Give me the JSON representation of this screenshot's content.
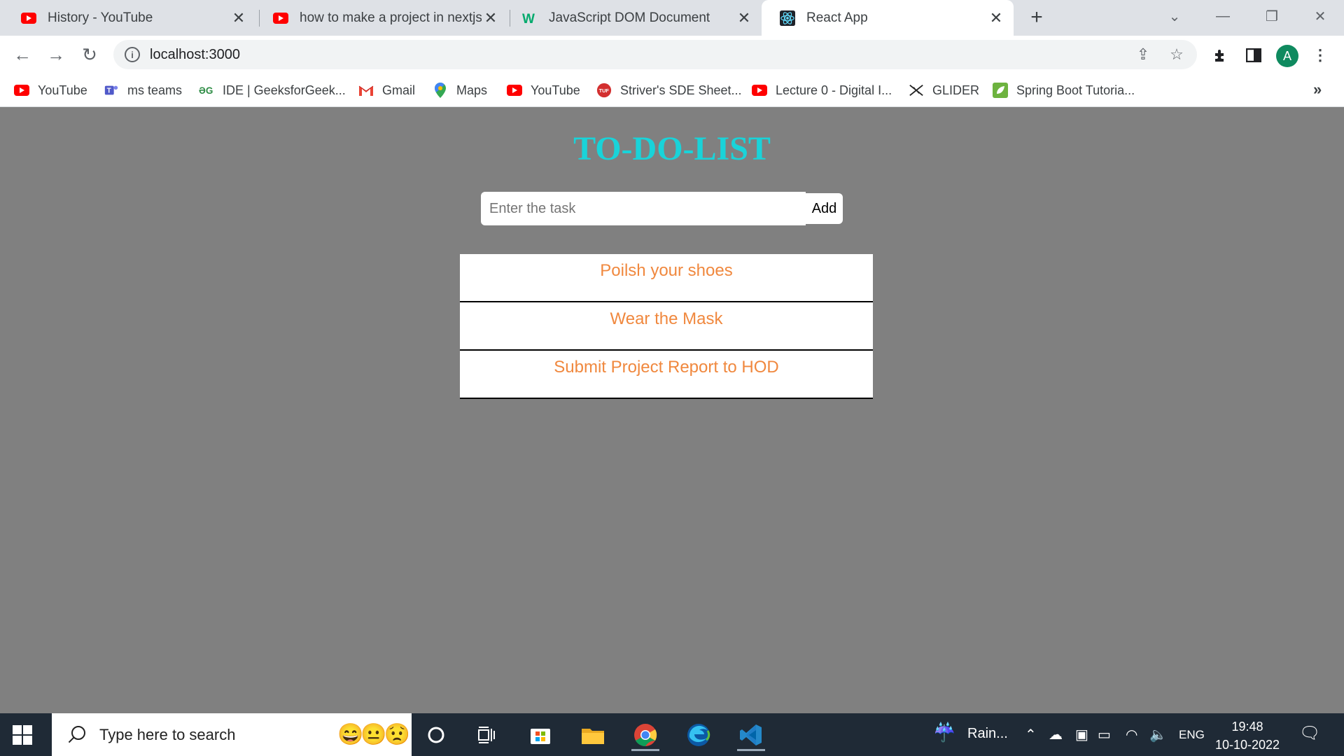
{
  "browser": {
    "tabs": [
      {
        "title": "History - YouTube",
        "icon": "youtube-icon"
      },
      {
        "title": "how to make a project in nextjs - ",
        "icon": "youtube-icon"
      },
      {
        "title": "JavaScript DOM Document",
        "icon": "w3-icon"
      },
      {
        "title": "React App",
        "icon": "react-icon",
        "active": true
      }
    ],
    "url": "localhost:3000",
    "profile_initial": "A",
    "bookmarks": [
      {
        "label": "YouTube",
        "icon": "youtube-icon"
      },
      {
        "label": "ms teams",
        "icon": "teams-icon"
      },
      {
        "label": "IDE | GeeksforGeek...",
        "icon": "gfg-icon"
      },
      {
        "label": "Gmail",
        "icon": "gmail-icon"
      },
      {
        "label": "Maps",
        "icon": "maps-icon"
      },
      {
        "label": "YouTube",
        "icon": "youtube-icon"
      },
      {
        "label": "Striver's SDE Sheet...",
        "icon": "tuf-icon"
      },
      {
        "label": "Lecture 0 - Digital I...",
        "icon": "youtube-icon"
      },
      {
        "label": "GLIDER",
        "icon": "glider-icon"
      },
      {
        "label": "Spring Boot Tutoria...",
        "icon": "spring-icon"
      }
    ],
    "bookmarks_more": "»"
  },
  "app": {
    "title": "TO-DO-LIST",
    "input_placeholder": "Enter the task",
    "add_label": "Add",
    "tasks": [
      "Poilsh your shoes",
      "Wear the Mask",
      "Submit Project Report to HOD"
    ],
    "colors": {
      "title": "#19d3d9",
      "task_text": "#f0883e",
      "background": "#808080"
    }
  },
  "taskbar": {
    "search_placeholder": "Type here to search",
    "weather": "Rain...",
    "language": "ENG",
    "time": "19:48",
    "date": "10-10-2022"
  }
}
